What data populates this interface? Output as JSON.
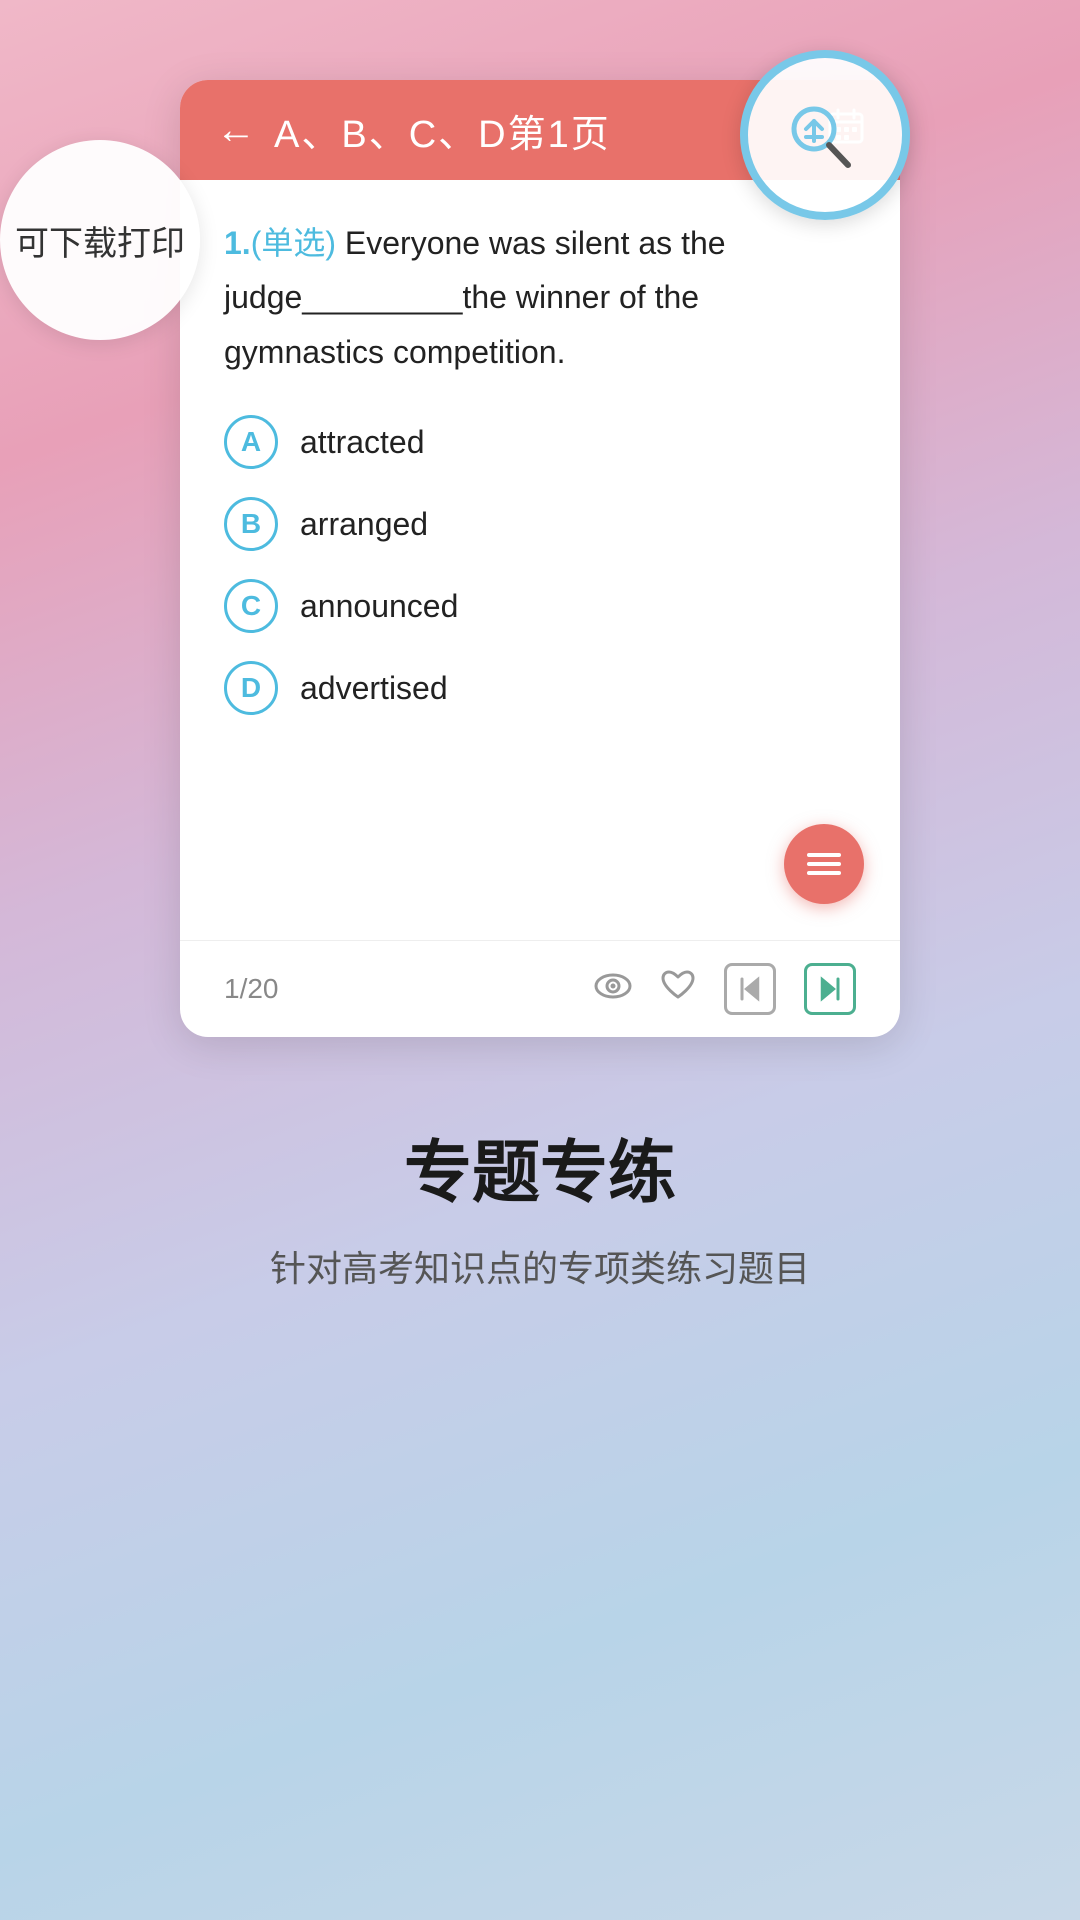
{
  "header": {
    "back_label": "←",
    "title": "A、B、C、D第1页",
    "calendar_icon": "📅",
    "download_tooltip": "可下载打印"
  },
  "question": {
    "number": "1.",
    "type": "(单选)",
    "text": " Everyone was silent as the judge_________the winner of the gymnastics competition."
  },
  "options": [
    {
      "letter": "A",
      "text": "attracted"
    },
    {
      "letter": "B",
      "text": "arranged"
    },
    {
      "letter": "C",
      "text": "announced"
    },
    {
      "letter": "D",
      "text": "advertised"
    }
  ],
  "footer": {
    "page": "1/20"
  },
  "bottom": {
    "title": "专题专练",
    "subtitle": "针对高考知识点的专项类练习题目"
  },
  "fab": {
    "label": "menu"
  }
}
